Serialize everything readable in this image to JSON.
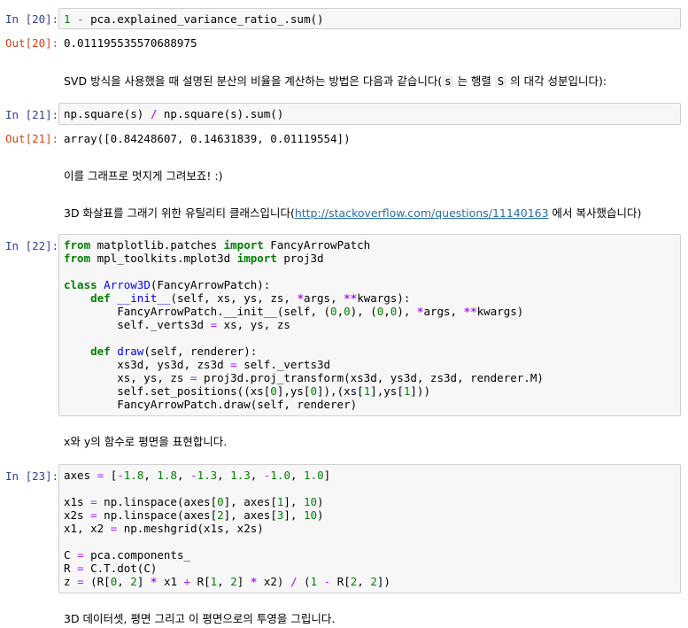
{
  "cells": {
    "c20": {
      "in_prompt": "In [20]:",
      "code_lines": [
        "1 - pca.explained_variance_ratio_.sum()"
      ],
      "out_prompt": "Out[20]:",
      "output": "0.011195535570688975"
    },
    "md1": {
      "before": "SVD 방식을 사용했을 때 설명된 분산의 비율을 계산하는 방법은 다음과 같습니다(",
      "code1": "s",
      "mid1": " 는 행렬 ",
      "code2": "S",
      "after": " 의 대각 성분입니다):"
    },
    "c21": {
      "in_prompt": "In [21]:",
      "code_lines": [
        "np.square(s) / np.square(s).sum()"
      ],
      "out_prompt": "Out[21]:",
      "output": "array([0.84248607, 0.14631839, 0.01119554])"
    },
    "md2": {
      "text": "이를 그래프로 멋지게 그려보죠! :)"
    },
    "md3": {
      "before": "3D 화살표를 그래기 위한 유틸리티 클래스입니다(",
      "link": "http://stackoverflow.com/questions/11140163",
      "after": " 에서 복사했습니다)"
    },
    "c22": {
      "in_prompt": "In [22]:",
      "code_lines": [
        "from matplotlib.patches import FancyArrowPatch",
        "from mpl_toolkits.mplot3d import proj3d",
        "",
        "class Arrow3D(FancyArrowPatch):",
        "    def __init__(self, xs, ys, zs, *args, **kwargs):",
        "        FancyArrowPatch.__init__(self, (0,0), (0,0), *args, **kwargs)",
        "        self._verts3d = xs, ys, zs",
        "",
        "    def draw(self, renderer):",
        "        xs3d, ys3d, zs3d = self._verts3d",
        "        xs, ys, zs = proj3d.proj_transform(xs3d, ys3d, zs3d, renderer.M)",
        "        self.set_positions((xs[0],ys[0]),(xs[1],ys[1]))",
        "        FancyArrowPatch.draw(self, renderer)"
      ]
    },
    "md4": {
      "text": "x와 y의 함수로 평면을 표현합니다."
    },
    "c23": {
      "in_prompt": "In [23]:",
      "code_lines": [
        "axes = [-1.8, 1.8, -1.3, 1.3, -1.0, 1.0]",
        "",
        "x1s = np.linspace(axes[0], axes[1], 10)",
        "x2s = np.linspace(axes[2], axes[3], 10)",
        "x1, x2 = np.meshgrid(x1s, x2s)",
        "",
        "C = pca.components_",
        "R = C.T.dot(C)",
        "z = (R[0, 2] * x1 + R[1, 2] * x2) / (1 - R[2, 2])"
      ]
    },
    "md5": {
      "text": "3D 데이터셋, 평면 그리고 이 평면으로의 투영을 그립니다."
    }
  }
}
